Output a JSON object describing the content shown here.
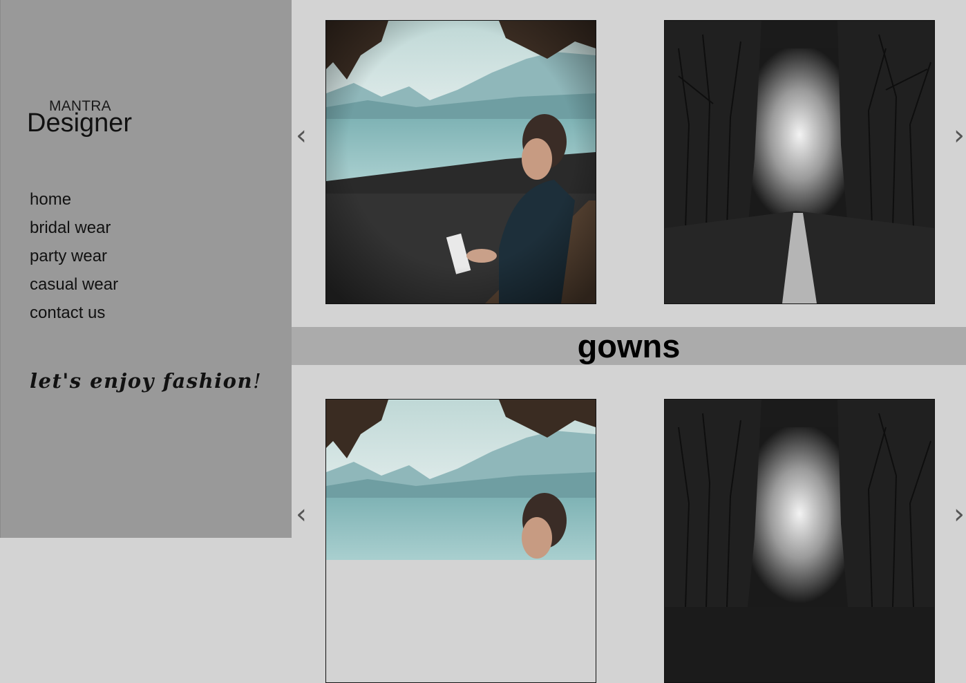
{
  "brand": {
    "top": "MANTRA",
    "main": "Designer"
  },
  "nav": [
    {
      "label": "home"
    },
    {
      "label": "bridal wear"
    },
    {
      "label": "party wear"
    },
    {
      "label": "casual wear"
    },
    {
      "label": "contact us"
    }
  ],
  "tagline": {
    "script": "let's enjoy fashion",
    "end": "!"
  },
  "slider": {
    "prev": "‹",
    "next": "›"
  },
  "section": {
    "title": "gowns"
  }
}
